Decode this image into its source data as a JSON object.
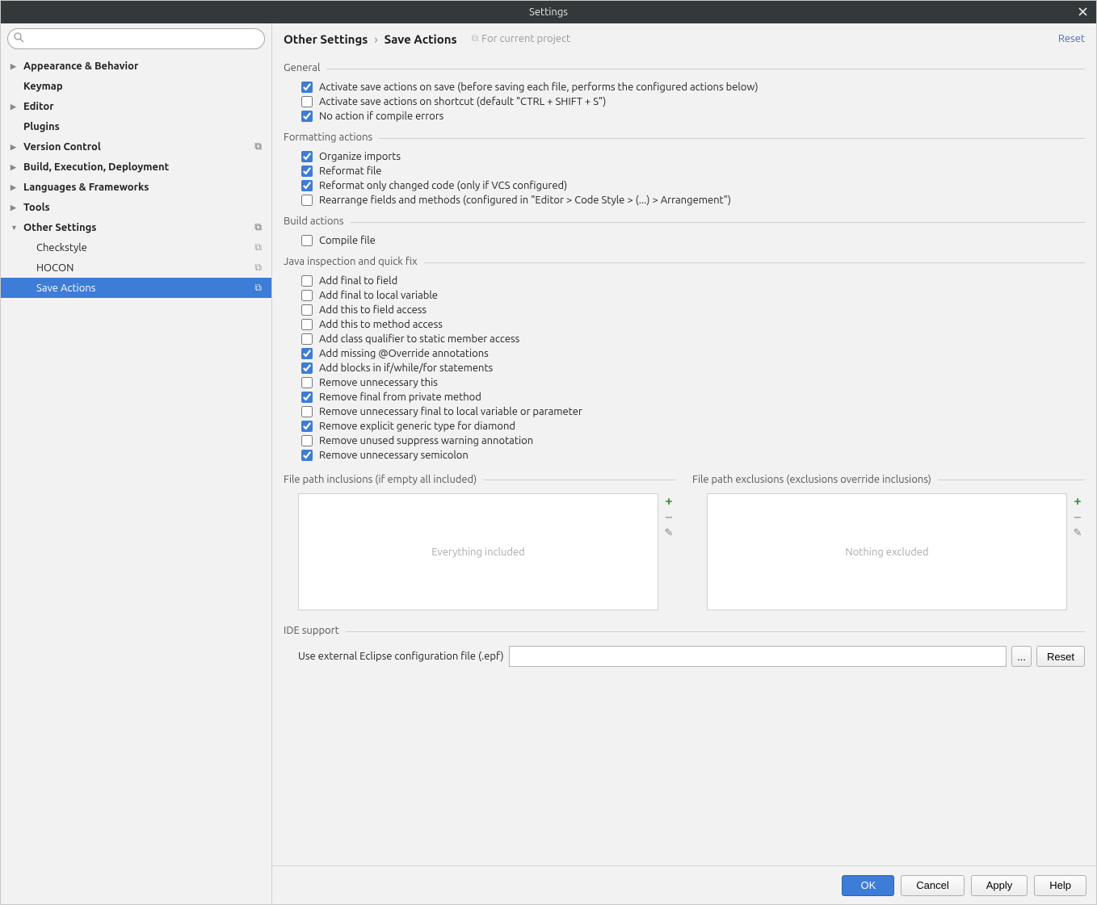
{
  "window": {
    "title": "Settings"
  },
  "search": {
    "placeholder": ""
  },
  "sidebar": {
    "items": [
      {
        "label": "Appearance & Behavior",
        "kind": "collapsed",
        "level": 1,
        "scope": false
      },
      {
        "label": "Keymap",
        "kind": "noarrow",
        "level": 1,
        "scope": false
      },
      {
        "label": "Editor",
        "kind": "collapsed",
        "level": 1,
        "scope": false
      },
      {
        "label": "Plugins",
        "kind": "noarrow",
        "level": 1,
        "scope": false
      },
      {
        "label": "Version Control",
        "kind": "collapsed",
        "level": 1,
        "scope": true
      },
      {
        "label": "Build, Execution, Deployment",
        "kind": "collapsed",
        "level": 1,
        "scope": false
      },
      {
        "label": "Languages & Frameworks",
        "kind": "collapsed",
        "level": 1,
        "scope": false
      },
      {
        "label": "Tools",
        "kind": "collapsed",
        "level": 1,
        "scope": false
      },
      {
        "label": "Other Settings",
        "kind": "expanded",
        "level": 1,
        "scope": true
      },
      {
        "label": "Checkstyle",
        "kind": "noarrow",
        "level": 2,
        "scope": true
      },
      {
        "label": "HOCON",
        "kind": "noarrow",
        "level": 2,
        "scope": true
      },
      {
        "label": "Save Actions",
        "kind": "noarrow",
        "level": 2,
        "scope": true,
        "selected": true
      }
    ]
  },
  "breadcrumb": {
    "parent": "Other Settings",
    "child": "Save Actions"
  },
  "scope_label": "For current project",
  "reset_label": "Reset",
  "sections": {
    "general": {
      "title": "General",
      "items": [
        {
          "label": "Activate save actions on save (before saving each file, performs the configured actions below)",
          "checked": true
        },
        {
          "label": "Activate save actions on shortcut (default \"CTRL + SHIFT + S\")",
          "checked": false
        },
        {
          "label": "No action if compile errors",
          "checked": true
        }
      ]
    },
    "formatting": {
      "title": "Formatting actions",
      "items": [
        {
          "label": "Organize imports",
          "checked": true
        },
        {
          "label": "Reformat file",
          "checked": true
        },
        {
          "label": "Reformat only changed code (only if VCS configured)",
          "checked": true
        },
        {
          "label": "Rearrange fields and methods (configured in \"Editor > Code Style > (...) > Arrangement\")",
          "checked": false
        }
      ]
    },
    "build": {
      "title": "Build actions",
      "items": [
        {
          "label": "Compile file",
          "checked": false
        }
      ]
    },
    "java": {
      "title": "Java inspection and quick fix",
      "items": [
        {
          "label": "Add final to field",
          "checked": false
        },
        {
          "label": "Add final to local variable",
          "checked": false
        },
        {
          "label": "Add this to field access",
          "checked": false
        },
        {
          "label": "Add this to method access",
          "checked": false
        },
        {
          "label": "Add class qualifier to static member access",
          "checked": false
        },
        {
          "label": "Add missing @Override annotations",
          "checked": true
        },
        {
          "label": "Add blocks in if/while/for statements",
          "checked": true
        },
        {
          "label": "Remove unnecessary this",
          "checked": false
        },
        {
          "label": "Remove final from private method",
          "checked": true
        },
        {
          "label": "Remove unnecessary final to local variable or parameter",
          "checked": false
        },
        {
          "label": "Remove explicit generic type for diamond",
          "checked": true
        },
        {
          "label": "Remove unused suppress warning annotation",
          "checked": false
        },
        {
          "label": "Remove unnecessary semicolon",
          "checked": true
        }
      ]
    }
  },
  "inclusions": {
    "title": "File path inclusions (if empty all included)",
    "placeholder": "Everything included"
  },
  "exclusions": {
    "title": "File path exclusions (exclusions override inclusions)",
    "placeholder": "Nothing excluded"
  },
  "ide": {
    "title": "IDE support",
    "field_label": "Use external Eclipse configuration file (.epf)",
    "value": "",
    "browse_label": "...",
    "reset_label": "Reset"
  },
  "footer": {
    "ok": "OK",
    "cancel": "Cancel",
    "apply": "Apply",
    "help": "Help"
  }
}
